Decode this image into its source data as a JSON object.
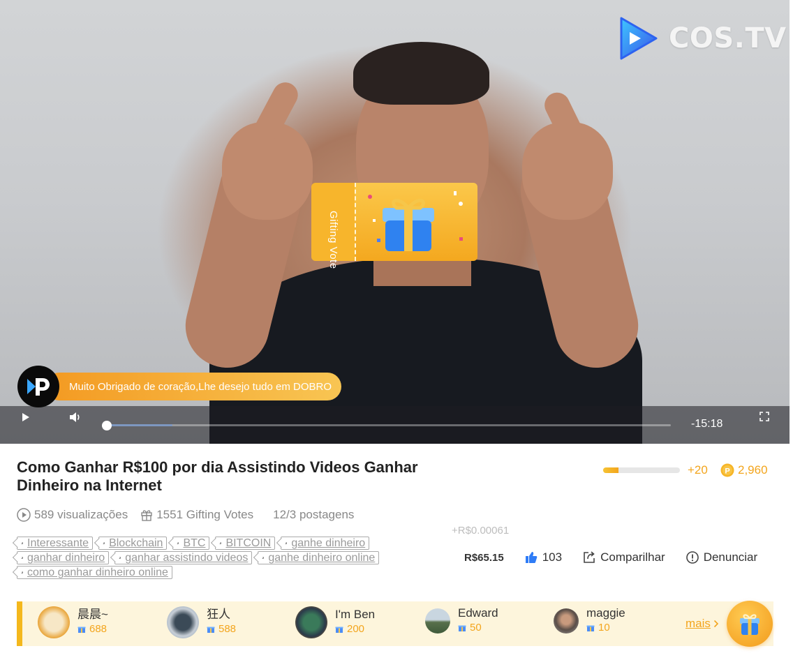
{
  "video": {
    "brand": "COS.TV",
    "ticket_label": "Gifting Vote",
    "notification_text": "Muito Obrigado de coração,Lhe desejo tudo em DOBRO",
    "time_remaining": "-15:18",
    "progress_fraction": 0.0,
    "buffered_fraction": 0.12
  },
  "info": {
    "title": "Como Ganhar R$100 por dia Assistindo Videos Ganhar Dinheiro na Internet",
    "level_fraction": 0.2,
    "plus": "+20",
    "coins": "2,960",
    "views": "589 visualizações",
    "gifting_votes": "1551 Gifting Votes",
    "posted": "12/3 postagens",
    "earnings": "+R$0.00061",
    "tags": [
      "Interessante",
      "Blockchain",
      "BTC",
      "BITCOIN",
      "ganhe dinheiro",
      "ganhar dinheiro",
      "ganhar assistindo videos",
      "ganhe dinheiro online",
      "como ganhar dinheiro online"
    ],
    "price": "R$65.15",
    "likes": "103",
    "share_label": "Comparilhar",
    "report_label": "Denunciar"
  },
  "gifters": [
    {
      "name": "晨晨~",
      "count": "688"
    },
    {
      "name": "狂人",
      "count": "588"
    },
    {
      "name": "I'm Ben",
      "count": "200"
    },
    {
      "name": "Edward",
      "count": "50"
    },
    {
      "name": "maggie",
      "count": "10"
    }
  ],
  "more_label": "mais",
  "colors": {
    "accent": "#f3a51d",
    "strip_bg": "#fdf5dc",
    "brand_blue": "#2f7cf6"
  }
}
